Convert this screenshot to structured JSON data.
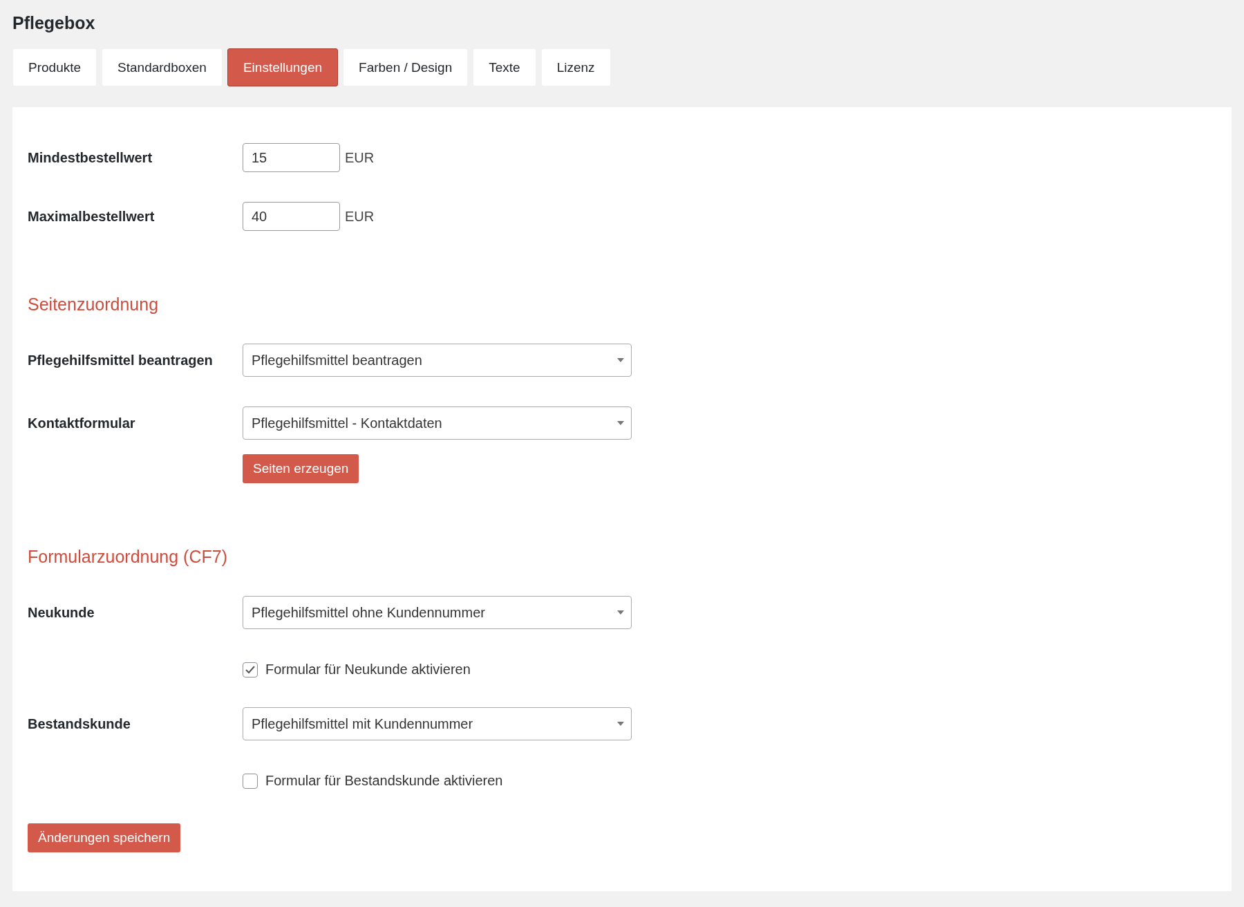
{
  "title": "Pflegebox",
  "tabs": [
    {
      "label": "Produkte",
      "selected": false
    },
    {
      "label": "Standardboxen",
      "selected": false
    },
    {
      "label": "Einstellungen",
      "selected": true
    },
    {
      "label": "Farben / Design",
      "selected": false
    },
    {
      "label": "Texte",
      "selected": false
    },
    {
      "label": "Lizenz",
      "selected": false
    }
  ],
  "rows": [
    {
      "kind": "input",
      "label": "Mindestbestellwert",
      "value": "15",
      "unit": "EUR"
    },
    {
      "kind": "input",
      "label": "Maximalbestellwert",
      "value": "40",
      "unit": "EUR"
    },
    {
      "kind": "heading",
      "text": "Seitenzuordnung"
    },
    {
      "kind": "select",
      "label": "Pflegehilfsmittel beantragen",
      "value": "Pflegehilfsmittel beantragen"
    },
    {
      "kind": "select",
      "label": "Kontaktformular",
      "value": "Pflegehilfsmittel - Kontaktdaten"
    },
    {
      "kind": "button",
      "label": "Seiten erzeugen"
    },
    {
      "kind": "heading",
      "text": "Formularzuordnung (CF7)"
    },
    {
      "kind": "select",
      "label": "Neukunde",
      "value": "Pflegehilfsmittel ohne Kundennummer"
    },
    {
      "kind": "checkbox",
      "label": "Formular für Neukunde aktivieren",
      "checked": true
    },
    {
      "kind": "select",
      "label": "Bestandskunde",
      "value": "Pflegehilfsmittel mit Kundennummer"
    },
    {
      "kind": "checkbox",
      "label": "Formular für Bestandskunde aktivieren",
      "checked": false
    }
  ],
  "save_button": "Änderungen speichern"
}
